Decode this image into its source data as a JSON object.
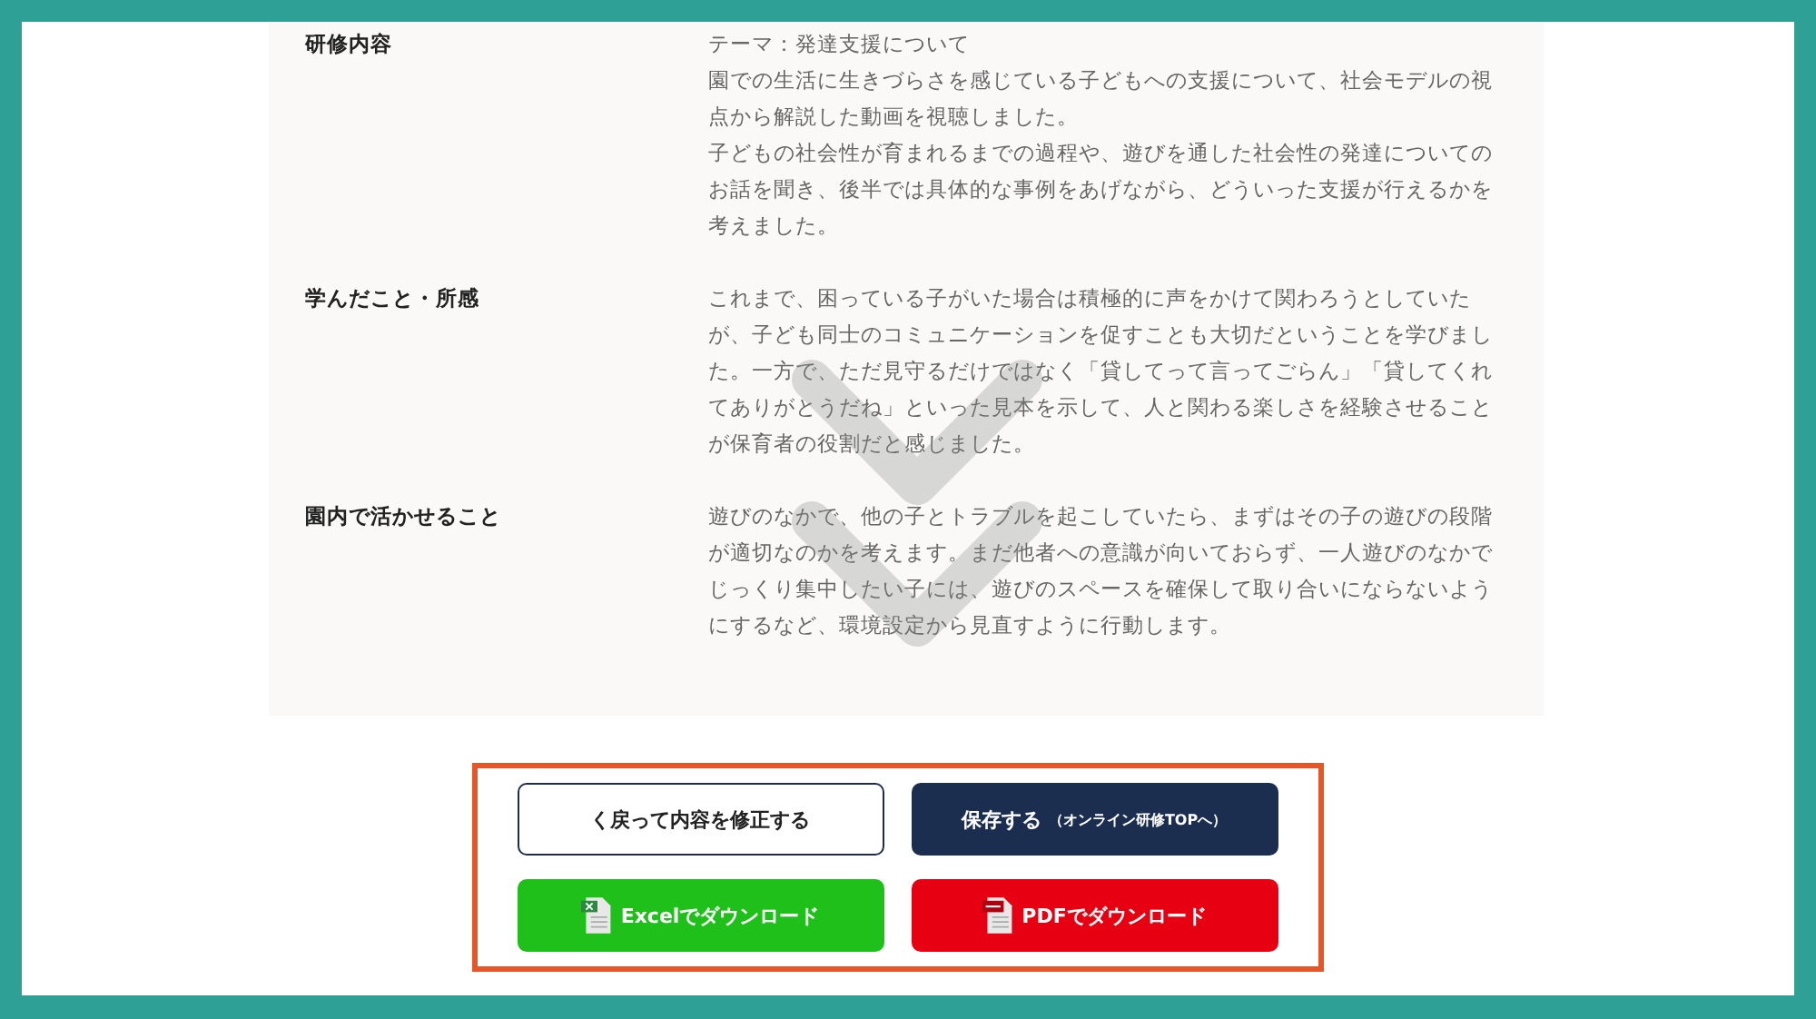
{
  "report": {
    "rows": [
      {
        "label": "研修内容",
        "paragraphs": [
          "テーマ：発達支援について",
          "園での生活に生きづらさを感じている子どもへの支援について、社会モデルの視点から解説した動画を視聴しました。",
          "子どもの社会性が育まれるまでの過程や、遊びを通した社会性の発達についてのお話を聞き、後半では具体的な事例をあげながら、どういった支援が行えるかを考えました。"
        ]
      },
      {
        "label": "学んだこと・所感",
        "paragraphs": [
          "これまで、困っている子がいた場合は積極的に声をかけて関わろうとしていたが、子ども同士のコミュニケーションを促すことも大切だということを学びました。一方で、ただ見守るだけではなく「貸してって言ってごらん」「貸してくれてありがとうだね」といった見本を示して、人と関わる楽しさを経験させることが保育者の役割だと感じました。"
        ]
      },
      {
        "label": "園内で活かせること",
        "paragraphs": [
          "遊びのなかで、他の子とトラブルを起こしていたら、まずはその子の遊びの段階が適切なのかを考えます。まだ他者への意識が向いておらず、一人遊びのなかでじっくり集中したい子には、遊びのスペースを確保して取り合いにならないようにするなど、環境設定から見直すように行動します。"
        ]
      }
    ]
  },
  "actions": [
    {
      "kind": "back",
      "label": "く戻って内容を修正する"
    },
    {
      "kind": "save",
      "label": "保存する",
      "note": "（オンライン研修TOPへ）"
    },
    {
      "kind": "excel",
      "label": "Excelでダウンロード"
    },
    {
      "kind": "pdf",
      "label": "PDFでダウンロード"
    }
  ]
}
